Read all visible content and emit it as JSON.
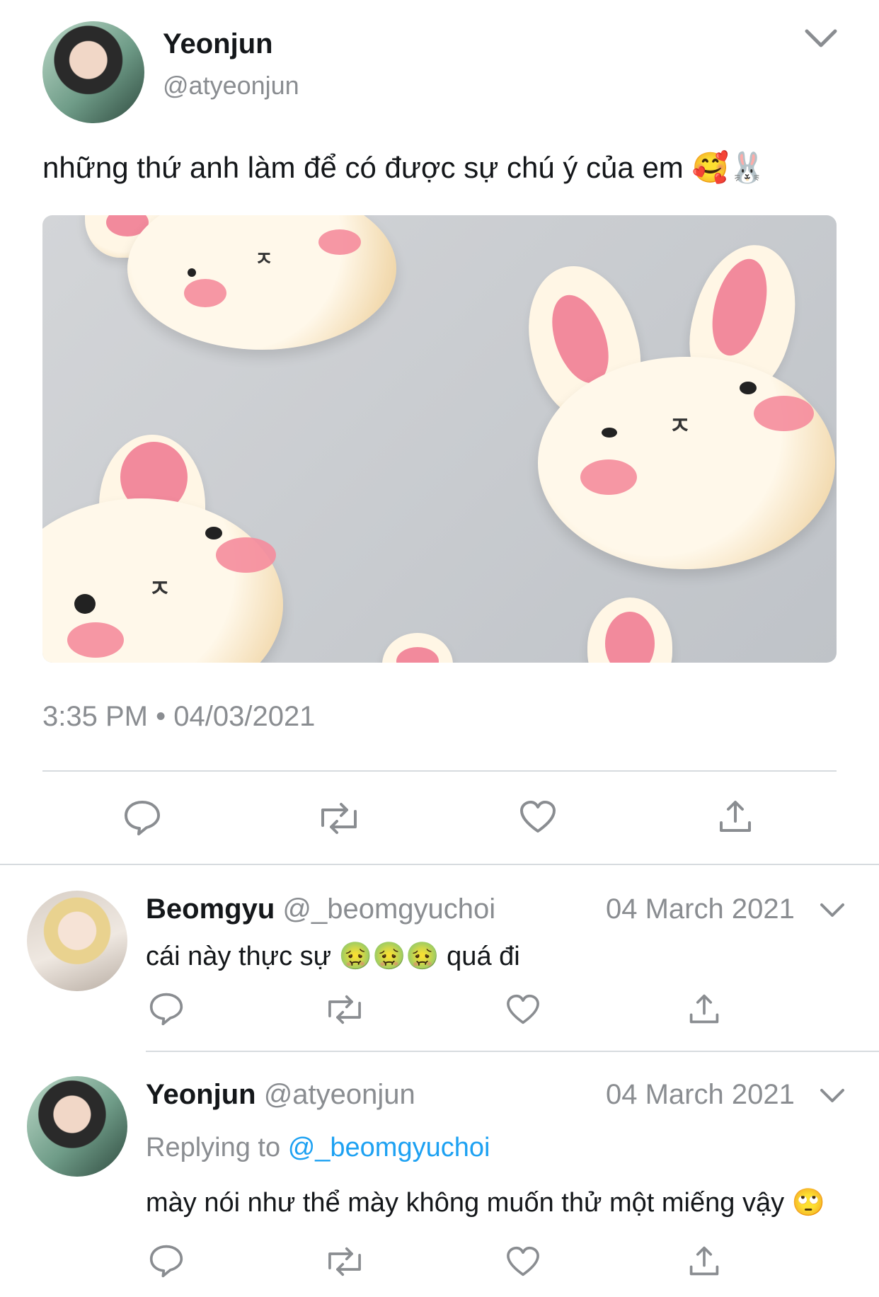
{
  "tweet": {
    "author_name": "Yeonjun",
    "author_handle": "@atyeonjun",
    "text": "những thứ anh làm để có được sự chú ý của em",
    "text_emoji": "🥰🐰",
    "time": "3:35 PM",
    "separator": "•",
    "date": "04/03/2021"
  },
  "replies": [
    {
      "author_name": "Beomgyu",
      "author_handle": "@_beomgyuchoi",
      "date": "04 March 2021",
      "text_before": "cái này thực sự",
      "emoji": "🤢🤢🤢",
      "text_after": "quá đi"
    },
    {
      "author_name": "Yeonjun",
      "author_handle": "@atyeonjun",
      "date": "04 March 2021",
      "replying_label": "Replying to",
      "replying_handle": "@_beomgyuchoi",
      "text": "mày nói như thể mày không muốn thử một miếng vậy",
      "emoji": "🙄"
    }
  ],
  "icons": {
    "reply": "reply-icon",
    "retweet": "retweet-icon",
    "like": "heart-icon",
    "share": "share-icon",
    "more": "chevron-down-icon"
  },
  "colors": {
    "text": "#14171a",
    "muted": "#8a8d91",
    "link": "#1da1f2",
    "divider": "#d7dbdf"
  }
}
